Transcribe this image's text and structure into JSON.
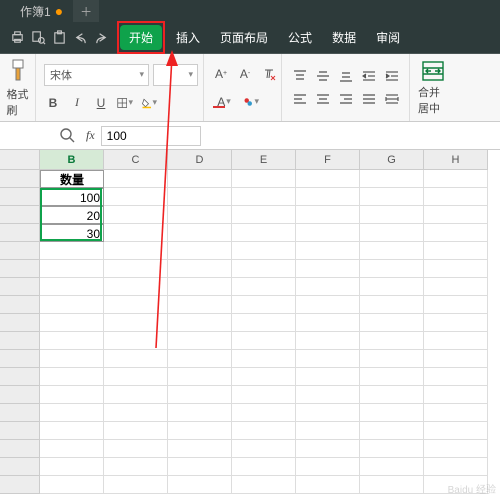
{
  "titlebar": {
    "doc_name": "作簿1"
  },
  "tabs": {
    "home": "开始",
    "insert": "插入",
    "layout": "页面布局",
    "formula": "公式",
    "data": "数据",
    "review": "审阅"
  },
  "ribbon": {
    "format_painter": "格式刷",
    "font_name": "宋体",
    "font_size": "",
    "merge_center": "合并居中"
  },
  "formula_bar": {
    "value": "100"
  },
  "grid": {
    "cols": [
      "B",
      "C",
      "D",
      "E",
      "F",
      "G",
      "H"
    ],
    "header": "数量",
    "vals": [
      "100",
      "20",
      "30"
    ]
  }
}
